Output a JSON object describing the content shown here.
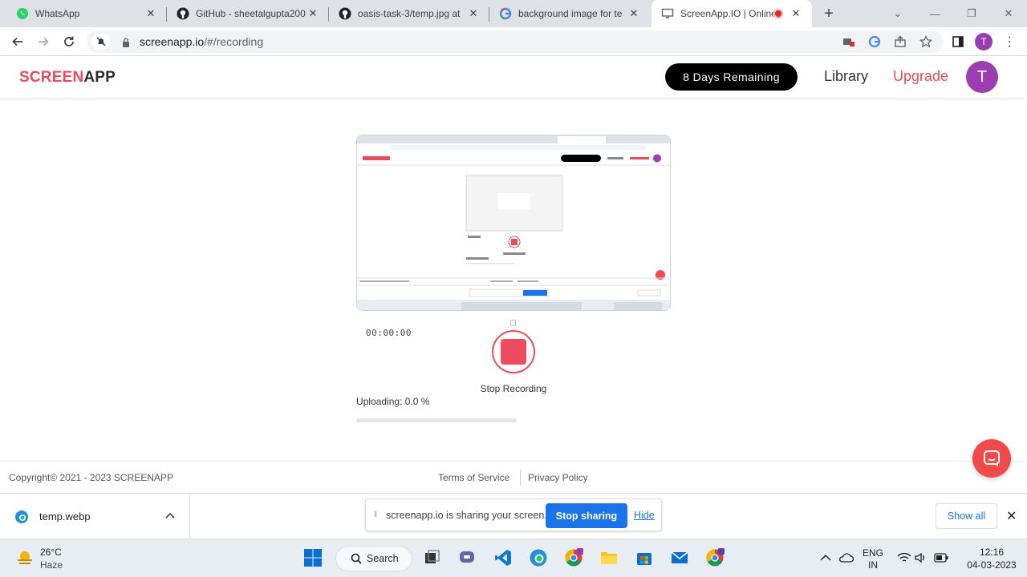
{
  "browser": {
    "tabs": [
      {
        "title": "WhatsApp",
        "icon": "whatsapp-icon",
        "active": false
      },
      {
        "title": "GitHub - sheetalgupta200",
        "icon": "github-icon",
        "active": false
      },
      {
        "title": "oasis-task-3/temp.jpg at",
        "icon": "github-icon",
        "active": false
      },
      {
        "title": "background image for te",
        "icon": "google-icon",
        "active": false
      },
      {
        "title": "ScreenApp.IO | Online",
        "icon": "monitor-icon",
        "active": true
      }
    ],
    "url_host": "screenapp.io",
    "url_path": "/#/recording",
    "profile_initial": "T"
  },
  "app": {
    "logo_part1": "SCREEN",
    "logo_part2": "APP",
    "days_remaining": "8 Days Remaining",
    "nav_library": "Library",
    "nav_upgrade": "Upgrade",
    "avatar_initial": "T"
  },
  "recording": {
    "timer": "00:00:00",
    "stop_label": "Stop Recording",
    "uploading_text": "Uploading: 0.0 %",
    "upload_progress": 0.0
  },
  "footer": {
    "copyright": "Copyright©  2021 - 2023 SCREENAPP",
    "terms": "Terms of Service",
    "privacy": "Privacy Policy"
  },
  "downloads": {
    "file_name": "temp.webp",
    "share_message": "screenapp.io is sharing your screen.",
    "stop_sharing": "Stop sharing",
    "hide": "Hide",
    "show_all": "Show all"
  },
  "taskbar": {
    "temperature": "26°C",
    "weather": "Haze",
    "search_label": "Search",
    "lang_line1": "ENG",
    "lang_line2": "IN",
    "time": "12:16",
    "date": "04-03-2023"
  },
  "colors": {
    "brand_red": "#e84c5c",
    "avatar_purple": "#9c3cb1",
    "link_blue": "#1a73e8"
  }
}
